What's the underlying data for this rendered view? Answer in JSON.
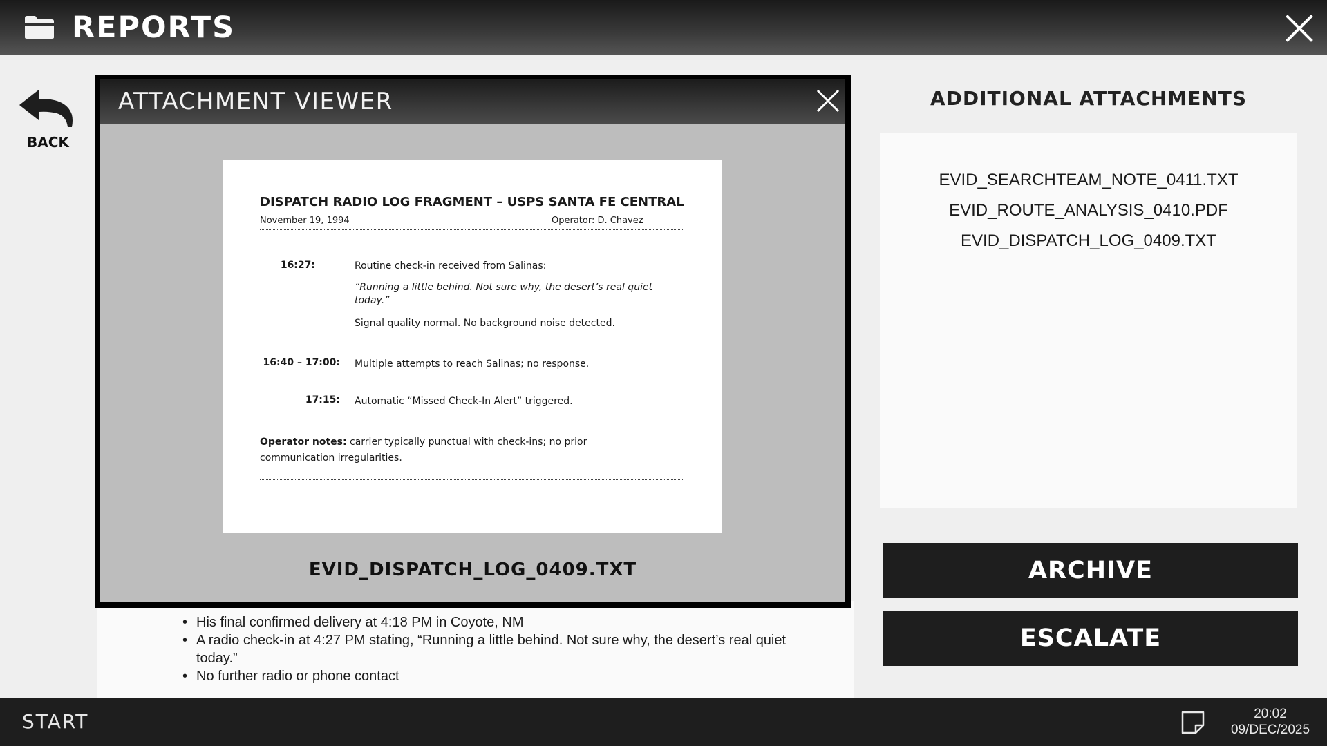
{
  "header": {
    "title": "REPORTS",
    "icon": "folder-icon"
  },
  "back": {
    "label": "BACK"
  },
  "viewer": {
    "title": "ATTACHMENT VIEWER",
    "filename": "EVID_DISPATCH_LOG_0409.TXT",
    "document": {
      "title": "DISPATCH RADIO LOG FRAGMENT – USPS SANTA FE CENTRAL",
      "date": "November 19, 1994",
      "operator": "Operator: D. Chavez",
      "entries": [
        {
          "time": "16:27:",
          "lines": [
            "Routine check-in received from Salinas:",
            "“Running a little behind. Not sure why, the desert’s real quiet today.”",
            "Signal quality normal. No background noise detected."
          ]
        },
        {
          "time": "16:40 – 17:00:",
          "lines": [
            "Multiple attempts to reach Salinas; no response."
          ]
        },
        {
          "time": "17:15:",
          "lines": [
            "Automatic “Missed Check-In Alert” triggered."
          ]
        }
      ],
      "notes_label": "Operator notes:",
      "notes_text": " carrier typically punctual with check-ins; no prior communication irregularities."
    }
  },
  "report": {
    "bullets": [
      "His final confirmed delivery at 4:18 PM in Coyote, NM",
      "A radio check-in at 4:27 PM stating, “Running a little behind. Not sure why, the desert’s real quiet today.”",
      "No further radio or phone contact"
    ]
  },
  "attachments": {
    "heading": "ADDITIONAL ATTACHMENTS",
    "items": [
      "EVID_SEARCHTEAM_NOTE_0411.TXT",
      "EVID_ROUTE_ANALYSIS_0410.PDF",
      "EVID_DISPATCH_LOG_0409.TXT"
    ]
  },
  "actions": {
    "archive": "ARCHIVE",
    "escalate": "ESCALATE"
  },
  "taskbar": {
    "start": "START",
    "time": "20:02",
    "date": "09/DEC/2025"
  },
  "colors": {
    "header": "#2b2b2b",
    "taskbar": "#1e1e1e",
    "button": "#1e1e1e",
    "viewer_body": "#bdbdbd"
  }
}
